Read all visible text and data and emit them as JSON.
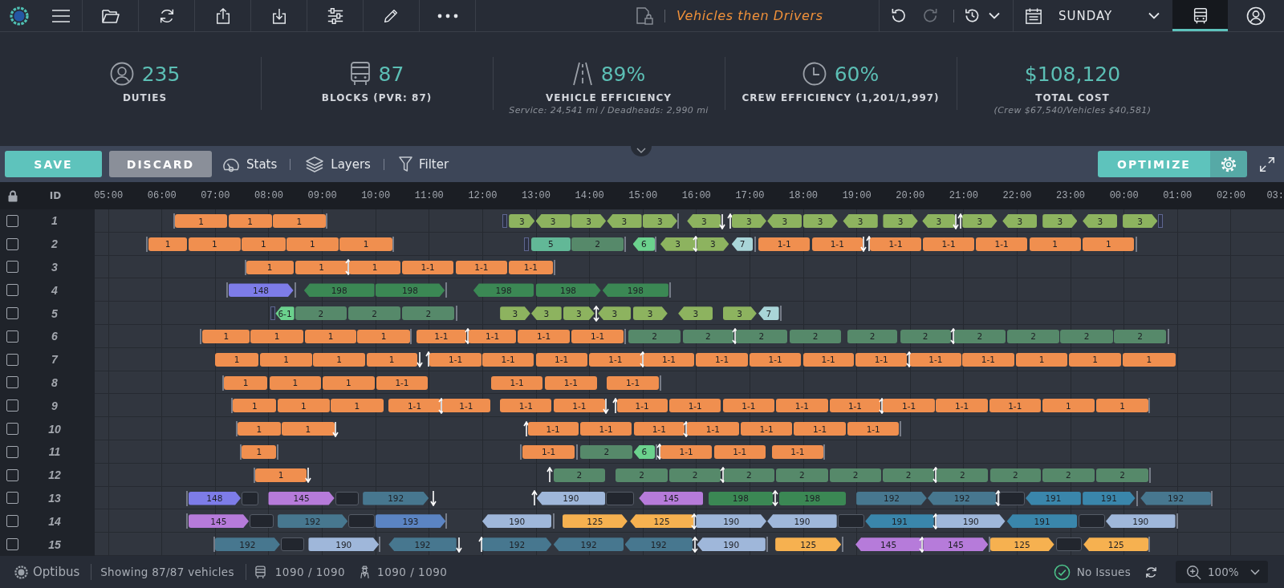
{
  "top_bar": {
    "history_buttons": [
      {
        "disabled": false
      },
      {
        "disabled": true
      }
    ],
    "scenario": "Vehicles then Drivers",
    "day": "SUNDAY",
    "view_tab": {
      "selected": true
    }
  },
  "stats": [
    {
      "value": "235",
      "label": "DUTIES"
    },
    {
      "value": "87",
      "label": "BLOCKS (PVR: 87)"
    },
    {
      "value": "89%",
      "label": "VEHICLE EFFICIENCY",
      "detail": "Service: 24,541 mi / Deadheads: 2,990 mi"
    },
    {
      "value": "60%",
      "label": "CREW EFFICIENCY (1,201/1,997)"
    },
    {
      "value": "$108,120",
      "label": "TOTAL COST",
      "detail": "(Crew $67,540/Vehicles $40,581)"
    }
  ],
  "action_bar": {
    "save": "SAVE",
    "discard": "DISCARD",
    "tools": [
      "Stats",
      "Layers",
      "Filter"
    ],
    "optimize": "OPTIMIZE"
  },
  "schedule": {
    "id_header": "ID",
    "time_labels": [
      "05:00",
      "06:00",
      "07:00",
      "08:00",
      "09:00",
      "10:00",
      "11:00",
      "12:00",
      "13:00",
      "14:00",
      "15:00",
      "16:00",
      "17:00",
      "18:00",
      "19:00",
      "20:00",
      "21:00",
      "22:00",
      "23:00",
      "00:00",
      "01:00",
      "02:00",
      "03:"
    ],
    "rows": [
      {
        "id": "1",
        "checked": false,
        "items": [
          {
            "kind": "bracket"
          },
          {
            "kind": "plain",
            "label": "1",
            "color": "#f08f4f"
          },
          {
            "kind": "plain",
            "label": "1",
            "color": "#f08f4f"
          },
          {
            "kind": "plain",
            "label": "1",
            "color": "#f08f4f"
          },
          {
            "kind": "bracket"
          },
          {
            "kind": "stub"
          },
          {
            "kind": "right",
            "label": "3",
            "color": "#8db35f"
          },
          {
            "kind": "left",
            "label": "3",
            "color": "#8db35f"
          },
          {
            "kind": "right",
            "label": "3",
            "color": "#8db35f"
          },
          {
            "kind": "left",
            "label": "3",
            "color": "#8db35f"
          },
          {
            "kind": "right",
            "label": "3",
            "color": "#8db35f"
          },
          {
            "kind": "bracket"
          },
          {
            "kind": "left",
            "label": "3",
            "color": "#8db35f"
          },
          {
            "kind": "down"
          },
          {
            "kind": "up"
          },
          {
            "kind": "right",
            "label": "3",
            "color": "#8db35f"
          },
          {
            "kind": "left",
            "label": "3",
            "color": "#8db35f"
          },
          {
            "kind": "right",
            "label": "3",
            "color": "#8db35f"
          },
          {
            "kind": "left",
            "label": "3",
            "color": "#8db35f"
          },
          {
            "kind": "right",
            "label": "3",
            "color": "#8db35f"
          },
          {
            "kind": "left",
            "label": "3",
            "color": "#8db35f"
          },
          {
            "kind": "down"
          },
          {
            "kind": "up"
          },
          {
            "kind": "right",
            "label": "3",
            "color": "#8db35f"
          },
          {
            "kind": "left",
            "label": "3",
            "color": "#8db35f"
          },
          {
            "kind": "right",
            "label": "3",
            "color": "#8db35f"
          },
          {
            "kind": "left",
            "label": "3",
            "color": "#8db35f"
          },
          {
            "kind": "right",
            "label": "3",
            "color": "#8db35f"
          },
          {
            "kind": "stub"
          }
        ]
      },
      {
        "id": "2",
        "checked": false,
        "items": [
          {
            "kind": "bracket"
          },
          {
            "kind": "plain",
            "label": "1",
            "color": "#f08f4f"
          },
          {
            "kind": "plain",
            "label": "1",
            "color": "#f08f4f"
          },
          {
            "kind": "plain",
            "label": "1",
            "color": "#f08f4f"
          },
          {
            "kind": "plain",
            "label": "1",
            "color": "#f08f4f"
          },
          {
            "kind": "plain",
            "label": "1",
            "color": "#f08f4f"
          },
          {
            "kind": "bracket"
          },
          {
            "kind": "stub"
          },
          {
            "kind": "plain",
            "label": "5",
            "color": "#62b897"
          },
          {
            "kind": "plain",
            "label": "2",
            "color": "#56896a"
          },
          {
            "kind": "bracket"
          },
          {
            "kind": "left",
            "label": "6",
            "color": "#6bd18d"
          },
          {
            "kind": "bracket"
          },
          {
            "kind": "left",
            "label": "3",
            "color": "#8db35f"
          },
          {
            "kind": "both"
          },
          {
            "kind": "right",
            "label": "3",
            "color": "#8db35f"
          },
          {
            "kind": "left",
            "label": "7",
            "color": "#a9d5d8"
          },
          {
            "kind": "bracket"
          },
          {
            "kind": "plain",
            "label": "1-1",
            "color": "#f08f4f"
          },
          {
            "kind": "plain",
            "label": "1-1",
            "color": "#f08f4f"
          },
          {
            "kind": "down"
          },
          {
            "kind": "up"
          },
          {
            "kind": "plain",
            "label": "1-1",
            "color": "#f08f4f"
          },
          {
            "kind": "plain",
            "label": "1-1",
            "color": "#f08f4f"
          },
          {
            "kind": "plain",
            "label": "1-1",
            "color": "#f08f4f"
          },
          {
            "kind": "plain",
            "label": "1",
            "color": "#f08f4f"
          },
          {
            "kind": "plain",
            "label": "1",
            "color": "#f08f4f"
          },
          {
            "kind": "bracket"
          }
        ]
      },
      {
        "id": "3",
        "checked": false,
        "items": [
          {
            "kind": "bracket"
          },
          {
            "kind": "plain",
            "label": "1",
            "color": "#f08f4f"
          },
          {
            "kind": "plain",
            "label": "1",
            "color": "#f08f4f"
          },
          {
            "kind": "both"
          },
          {
            "kind": "plain",
            "label": "1",
            "color": "#f08f4f"
          },
          {
            "kind": "plain",
            "label": "1-1",
            "color": "#f08f4f"
          },
          {
            "kind": "plain",
            "label": "1-1",
            "color": "#f08f4f"
          },
          {
            "kind": "plain",
            "label": "1-1",
            "color": "#f08f4f"
          },
          {
            "kind": "bracket"
          }
        ]
      },
      {
        "id": "4",
        "checked": false,
        "items": [
          {
            "kind": "bracket"
          },
          {
            "kind": "right",
            "label": "148",
            "color": "#7d7ce8"
          },
          {
            "kind": "bracket"
          },
          {
            "kind": "left",
            "label": "198",
            "color": "#3b8854"
          },
          {
            "kind": "right",
            "label": "198",
            "color": "#3b8854"
          },
          {
            "kind": "bracket"
          },
          {
            "kind": "left",
            "label": "198",
            "color": "#3b8854"
          },
          {
            "kind": "right",
            "label": "198",
            "color": "#3b8854"
          },
          {
            "kind": "left",
            "label": "198",
            "color": "#3b8854"
          },
          {
            "kind": "bracket"
          }
        ]
      },
      {
        "id": "5",
        "checked": false,
        "items": [
          {
            "kind": "stub"
          },
          {
            "kind": "left",
            "label": "6-1",
            "color": "#6bd18d"
          },
          {
            "kind": "plain",
            "label": "2",
            "color": "#56896a"
          },
          {
            "kind": "plain",
            "label": "2",
            "color": "#56896a"
          },
          {
            "kind": "plain",
            "label": "2",
            "color": "#56896a"
          },
          {
            "kind": "bracket"
          },
          {
            "kind": "right",
            "label": "3",
            "color": "#8db35f"
          },
          {
            "kind": "left",
            "label": "3",
            "color": "#8db35f"
          },
          {
            "kind": "right",
            "label": "3",
            "color": "#8db35f"
          },
          {
            "kind": "both"
          },
          {
            "kind": "left",
            "label": "3",
            "color": "#8db35f"
          },
          {
            "kind": "right",
            "label": "3",
            "color": "#8db35f"
          },
          {
            "kind": "left",
            "label": "3",
            "color": "#8db35f"
          },
          {
            "kind": "right",
            "label": "3",
            "color": "#8db35f"
          },
          {
            "kind": "left",
            "label": "7",
            "color": "#a9d5d8"
          },
          {
            "kind": "bracket"
          }
        ]
      },
      {
        "id": "6",
        "checked": false,
        "items": [
          {
            "kind": "bracket"
          },
          {
            "kind": "plain",
            "label": "1",
            "color": "#f08f4f"
          },
          {
            "kind": "plain",
            "label": "1",
            "color": "#f08f4f"
          },
          {
            "kind": "plain",
            "label": "1",
            "color": "#f08f4f"
          },
          {
            "kind": "plain",
            "label": "1",
            "color": "#f08f4f"
          },
          {
            "kind": "bracket"
          },
          {
            "kind": "plain",
            "label": "1-1",
            "color": "#f08f4f"
          },
          {
            "kind": "both"
          },
          {
            "kind": "plain",
            "label": "1-1",
            "color": "#f08f4f"
          },
          {
            "kind": "plain",
            "label": "1-1",
            "color": "#f08f4f"
          },
          {
            "kind": "plain",
            "label": "1-1",
            "color": "#f08f4f"
          },
          {
            "kind": "bracket"
          },
          {
            "kind": "plain",
            "label": "2",
            "color": "#56896a"
          },
          {
            "kind": "plain",
            "label": "2",
            "color": "#56896a"
          },
          {
            "kind": "both"
          },
          {
            "kind": "plain",
            "label": "2",
            "color": "#56896a"
          },
          {
            "kind": "plain",
            "label": "2",
            "color": "#56896a"
          },
          {
            "kind": "plain",
            "label": "2",
            "color": "#56896a"
          },
          {
            "kind": "plain",
            "label": "2",
            "color": "#56896a"
          },
          {
            "kind": "both"
          },
          {
            "kind": "plain",
            "label": "2",
            "color": "#56896a"
          },
          {
            "kind": "plain",
            "label": "2",
            "color": "#56896a"
          },
          {
            "kind": "plain",
            "label": "2",
            "color": "#56896a"
          },
          {
            "kind": "plain",
            "label": "2",
            "color": "#56896a"
          },
          {
            "kind": "bracket"
          }
        ]
      },
      {
        "id": "7",
        "checked": false,
        "items": [
          {
            "kind": "plain",
            "label": "1",
            "color": "#f08f4f"
          },
          {
            "kind": "plain",
            "label": "1",
            "color": "#f08f4f"
          },
          {
            "kind": "plain",
            "label": "1",
            "color": "#f08f4f"
          },
          {
            "kind": "plain",
            "label": "1",
            "color": "#f08f4f"
          },
          {
            "kind": "down"
          },
          {
            "kind": "up"
          },
          {
            "kind": "plain",
            "label": "1-1",
            "color": "#f08f4f"
          },
          {
            "kind": "plain",
            "label": "1-1",
            "color": "#f08f4f"
          },
          {
            "kind": "plain",
            "label": "1-1",
            "color": "#f08f4f"
          },
          {
            "kind": "plain",
            "label": "1-1",
            "color": "#f08f4f"
          },
          {
            "kind": "both"
          },
          {
            "kind": "plain",
            "label": "1-1",
            "color": "#f08f4f"
          },
          {
            "kind": "plain",
            "label": "1-1",
            "color": "#f08f4f"
          },
          {
            "kind": "plain",
            "label": "1-1",
            "color": "#f08f4f"
          },
          {
            "kind": "plain",
            "label": "1-1",
            "color": "#f08f4f"
          },
          {
            "kind": "plain",
            "label": "1-1",
            "color": "#f08f4f"
          },
          {
            "kind": "both"
          },
          {
            "kind": "plain",
            "label": "1-1",
            "color": "#f08f4f"
          },
          {
            "kind": "plain",
            "label": "1-1",
            "color": "#f08f4f"
          },
          {
            "kind": "plain",
            "label": "1",
            "color": "#f08f4f"
          },
          {
            "kind": "plain",
            "label": "1",
            "color": "#f08f4f"
          },
          {
            "kind": "plain",
            "label": "1",
            "color": "#f08f4f"
          }
        ]
      },
      {
        "id": "8",
        "checked": false,
        "items": [
          {
            "kind": "bracket"
          },
          {
            "kind": "plain",
            "label": "1",
            "color": "#f08f4f"
          },
          {
            "kind": "plain",
            "label": "1",
            "color": "#f08f4f"
          },
          {
            "kind": "plain",
            "label": "1",
            "color": "#f08f4f"
          },
          {
            "kind": "plain",
            "label": "1-1",
            "color": "#f08f4f"
          },
          {
            "kind": "plain",
            "label": "1-1",
            "color": "#f08f4f"
          },
          {
            "kind": "plain",
            "label": "1-1",
            "color": "#f08f4f"
          },
          {
            "kind": "plain",
            "label": "1-1",
            "color": "#f08f4f"
          },
          {
            "kind": "bracket"
          }
        ]
      },
      {
        "id": "9",
        "checked": false,
        "items": [
          {
            "kind": "bracket"
          },
          {
            "kind": "plain",
            "label": "1",
            "color": "#f08f4f"
          },
          {
            "kind": "plain",
            "label": "1",
            "color": "#f08f4f"
          },
          {
            "kind": "plain",
            "label": "1",
            "color": "#f08f4f"
          },
          {
            "kind": "plain",
            "label": "1-1",
            "color": "#f08f4f"
          },
          {
            "kind": "both"
          },
          {
            "kind": "plain",
            "label": "1-1",
            "color": "#f08f4f"
          },
          {
            "kind": "plain",
            "label": "1-1",
            "color": "#f08f4f"
          },
          {
            "kind": "plain",
            "label": "1-1",
            "color": "#f08f4f"
          },
          {
            "kind": "down"
          },
          {
            "kind": "up"
          },
          {
            "kind": "plain",
            "label": "1-1",
            "color": "#f08f4f"
          },
          {
            "kind": "plain",
            "label": "1-1",
            "color": "#f08f4f"
          },
          {
            "kind": "plain",
            "label": "1-1",
            "color": "#f08f4f"
          },
          {
            "kind": "plain",
            "label": "1-1",
            "color": "#f08f4f"
          },
          {
            "kind": "plain",
            "label": "1-1",
            "color": "#f08f4f"
          },
          {
            "kind": "both"
          },
          {
            "kind": "plain",
            "label": "1-1",
            "color": "#f08f4f"
          },
          {
            "kind": "plain",
            "label": "1-1",
            "color": "#f08f4f"
          },
          {
            "kind": "plain",
            "label": "1-1",
            "color": "#f08f4f"
          },
          {
            "kind": "plain",
            "label": "1",
            "color": "#f08f4f"
          },
          {
            "kind": "plain",
            "label": "1",
            "color": "#f08f4f"
          },
          {
            "kind": "bracket"
          }
        ]
      },
      {
        "id": "10",
        "checked": false,
        "items": [
          {
            "kind": "bracket"
          },
          {
            "kind": "plain",
            "label": "1",
            "color": "#f08f4f"
          },
          {
            "kind": "plain",
            "label": "1",
            "color": "#f08f4f"
          },
          {
            "kind": "down"
          },
          {
            "kind": "up"
          },
          {
            "kind": "plain",
            "label": "1-1",
            "color": "#f08f4f"
          },
          {
            "kind": "plain",
            "label": "1-1",
            "color": "#f08f4f"
          },
          {
            "kind": "plain",
            "label": "1-1",
            "color": "#f08f4f"
          },
          {
            "kind": "both"
          },
          {
            "kind": "plain",
            "label": "1-1",
            "color": "#f08f4f"
          },
          {
            "kind": "plain",
            "label": "1-1",
            "color": "#f08f4f"
          },
          {
            "kind": "plain",
            "label": "1-1",
            "color": "#f08f4f"
          },
          {
            "kind": "plain",
            "label": "1-1",
            "color": "#f08f4f"
          },
          {
            "kind": "bracket"
          }
        ]
      },
      {
        "id": "11",
        "checked": false,
        "items": [
          {
            "kind": "bracket"
          },
          {
            "kind": "plain",
            "label": "1",
            "color": "#f08f4f"
          },
          {
            "kind": "bracket"
          },
          {
            "kind": "bracket"
          },
          {
            "kind": "plain",
            "label": "1-1",
            "color": "#f08f4f"
          },
          {
            "kind": "bracket"
          },
          {
            "kind": "plain",
            "label": "2",
            "color": "#56896a"
          },
          {
            "kind": "left",
            "label": "6",
            "color": "#6bd18d"
          },
          {
            "kind": "bracket"
          },
          {
            "kind": "both"
          },
          {
            "kind": "plain",
            "label": "1-1",
            "color": "#f08f4f"
          },
          {
            "kind": "plain",
            "label": "1-1",
            "color": "#f08f4f"
          },
          {
            "kind": "plain",
            "label": "1-1",
            "color": "#f08f4f"
          },
          {
            "kind": "bracket"
          }
        ]
      },
      {
        "id": "12",
        "checked": false,
        "items": [
          {
            "kind": "bracket"
          },
          {
            "kind": "plain",
            "label": "1",
            "color": "#f08f4f"
          },
          {
            "kind": "down"
          },
          {
            "kind": "up"
          },
          {
            "kind": "plain",
            "label": "2",
            "color": "#56896a"
          },
          {
            "kind": "plain",
            "label": "2",
            "color": "#56896a"
          },
          {
            "kind": "plain",
            "label": "2",
            "color": "#56896a"
          },
          {
            "kind": "both"
          },
          {
            "kind": "plain",
            "label": "2",
            "color": "#56896a"
          },
          {
            "kind": "plain",
            "label": "2",
            "color": "#56896a"
          },
          {
            "kind": "plain",
            "label": "2",
            "color": "#56896a"
          },
          {
            "kind": "plain",
            "label": "2",
            "color": "#56896a"
          },
          {
            "kind": "both"
          },
          {
            "kind": "plain",
            "label": "2",
            "color": "#56896a"
          },
          {
            "kind": "plain",
            "label": "2",
            "color": "#56896a"
          },
          {
            "kind": "plain",
            "label": "2",
            "color": "#56896a"
          },
          {
            "kind": "plain",
            "label": "2",
            "color": "#56896a"
          },
          {
            "kind": "bracket"
          }
        ]
      },
      {
        "id": "13",
        "checked": false,
        "items": [
          {
            "kind": "bracket"
          },
          {
            "kind": "right",
            "label": "148",
            "color": "#7d7ce8"
          },
          {
            "kind": "idle"
          },
          {
            "kind": "right",
            "label": "145",
            "color": "#b67bda"
          },
          {
            "kind": "idle"
          },
          {
            "kind": "right",
            "label": "192",
            "color": "#47778f"
          },
          {
            "kind": "down"
          },
          {
            "kind": "up"
          },
          {
            "kind": "left",
            "label": "190",
            "color": "#9fb7da"
          },
          {
            "kind": "idle"
          },
          {
            "kind": "left",
            "label": "145",
            "color": "#b67bda"
          },
          {
            "kind": "plain",
            "label": "198",
            "color": "#3b8854"
          },
          {
            "kind": "both"
          },
          {
            "kind": "plain",
            "label": "198",
            "color": "#3b8854"
          },
          {
            "kind": "right",
            "label": "192",
            "color": "#47778f"
          },
          {
            "kind": "left",
            "label": "192",
            "color": "#47778f"
          },
          {
            "kind": "both"
          },
          {
            "kind": "idle"
          },
          {
            "kind": "left",
            "label": "191",
            "color": "#3a86ab"
          },
          {
            "kind": "right",
            "label": "191",
            "color": "#3a86ab"
          },
          {
            "kind": "bracket"
          },
          {
            "kind": "left",
            "label": "192",
            "color": "#47778f"
          },
          {
            "kind": "bracket"
          }
        ]
      },
      {
        "id": "14",
        "checked": false,
        "items": [
          {
            "kind": "bracket"
          },
          {
            "kind": "right",
            "label": "145",
            "color": "#b67bda"
          },
          {
            "kind": "idle"
          },
          {
            "kind": "right",
            "label": "192",
            "color": "#47778f"
          },
          {
            "kind": "idle"
          },
          {
            "kind": "right",
            "label": "193",
            "color": "#5b84c3"
          },
          {
            "kind": "bracket"
          },
          {
            "kind": "left",
            "label": "190",
            "color": "#9fb7da"
          },
          {
            "kind": "bracket"
          },
          {
            "kind": "right",
            "label": "125",
            "color": "#f6b150"
          },
          {
            "kind": "left",
            "label": "125",
            "color": "#f6b150"
          },
          {
            "kind": "both"
          },
          {
            "kind": "right",
            "label": "190",
            "color": "#9fb7da"
          },
          {
            "kind": "left",
            "label": "190",
            "color": "#9fb7da"
          },
          {
            "kind": "idle"
          },
          {
            "kind": "left",
            "label": "191",
            "color": "#3a86ab"
          },
          {
            "kind": "both"
          },
          {
            "kind": "right",
            "label": "190",
            "color": "#9fb7da"
          },
          {
            "kind": "left",
            "label": "191",
            "color": "#3a86ab"
          },
          {
            "kind": "idle"
          },
          {
            "kind": "left",
            "label": "190",
            "color": "#9fb7da"
          },
          {
            "kind": "bracket"
          }
        ]
      },
      {
        "id": "15",
        "checked": false,
        "items": [
          {
            "kind": "bracket"
          },
          {
            "kind": "right",
            "label": "192",
            "color": "#47778f"
          },
          {
            "kind": "idle"
          },
          {
            "kind": "right",
            "label": "190",
            "color": "#9fb7da"
          },
          {
            "kind": "bracket"
          },
          {
            "kind": "left",
            "label": "192",
            "color": "#47778f"
          },
          {
            "kind": "down"
          },
          {
            "kind": "up"
          },
          {
            "kind": "right",
            "label": "192",
            "color": "#47778f"
          },
          {
            "kind": "left",
            "label": "192",
            "color": "#47778f"
          },
          {
            "kind": "left",
            "label": "192",
            "color": "#47778f"
          },
          {
            "kind": "both"
          },
          {
            "kind": "left",
            "label": "190",
            "color": "#9fb7da"
          },
          {
            "kind": "bracket"
          },
          {
            "kind": "right",
            "label": "125",
            "color": "#f6b150"
          },
          {
            "kind": "bracket"
          },
          {
            "kind": "left",
            "label": "145",
            "color": "#b67bda"
          },
          {
            "kind": "both"
          },
          {
            "kind": "right",
            "label": "145",
            "color": "#b67bda"
          },
          {
            "kind": "bracket"
          },
          {
            "kind": "right",
            "label": "125",
            "color": "#f6b150"
          },
          {
            "kind": "idle"
          },
          {
            "kind": "left",
            "label": "125",
            "color": "#f6b150"
          },
          {
            "kind": "bracket"
          }
        ]
      }
    ]
  },
  "status_bar": {
    "brand": "Optibus",
    "summary": "Showing 87/87 vehicles",
    "vehicle_count": "1090 / 1090",
    "driver_count": "1090 / 1090",
    "issues": "No Issues",
    "zoom": "100%"
  }
}
